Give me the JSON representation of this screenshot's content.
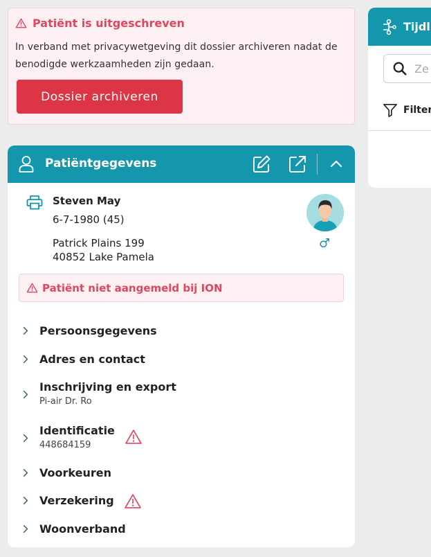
{
  "discharge_alert": {
    "title": "Patiënt is uitgeschreven",
    "text": "In verband met privacywetgeving dit dossier archiveren nadat de benodigde werkzaamheden zijn gedaan.",
    "button_label": "Dossier archiveren"
  },
  "timeline_panel": {
    "title": "Tijdl",
    "search_placeholder": "Ze",
    "filter_label": "Filter"
  },
  "patient_panel": {
    "title": "Patiëntgegevens",
    "name": "Steven May",
    "dob": "6-7-1980 (45)",
    "address_line1": "Patrick Plains 199",
    "address_line2": "40852 Lake Pamela",
    "gender_symbol": "♂",
    "ion_alert": "Patiënt niet aangemeld bij ION",
    "sections": [
      {
        "label": "Persoonsgegevens"
      },
      {
        "label": "Adres en contact"
      },
      {
        "label": "Inschrijving en export",
        "sub": "Pi-air Dr. Ro"
      },
      {
        "label": "Identificatie",
        "sub": "448684159",
        "warning": true
      },
      {
        "label": "Voorkeuren"
      },
      {
        "label": "Verzekering",
        "warning": true
      },
      {
        "label": "Woonverband"
      }
    ]
  },
  "colors": {
    "accent": "#1497ad",
    "danger": "#dc3545",
    "alert_text": "#e0465e",
    "alert_bg": "#fdf0f2"
  }
}
